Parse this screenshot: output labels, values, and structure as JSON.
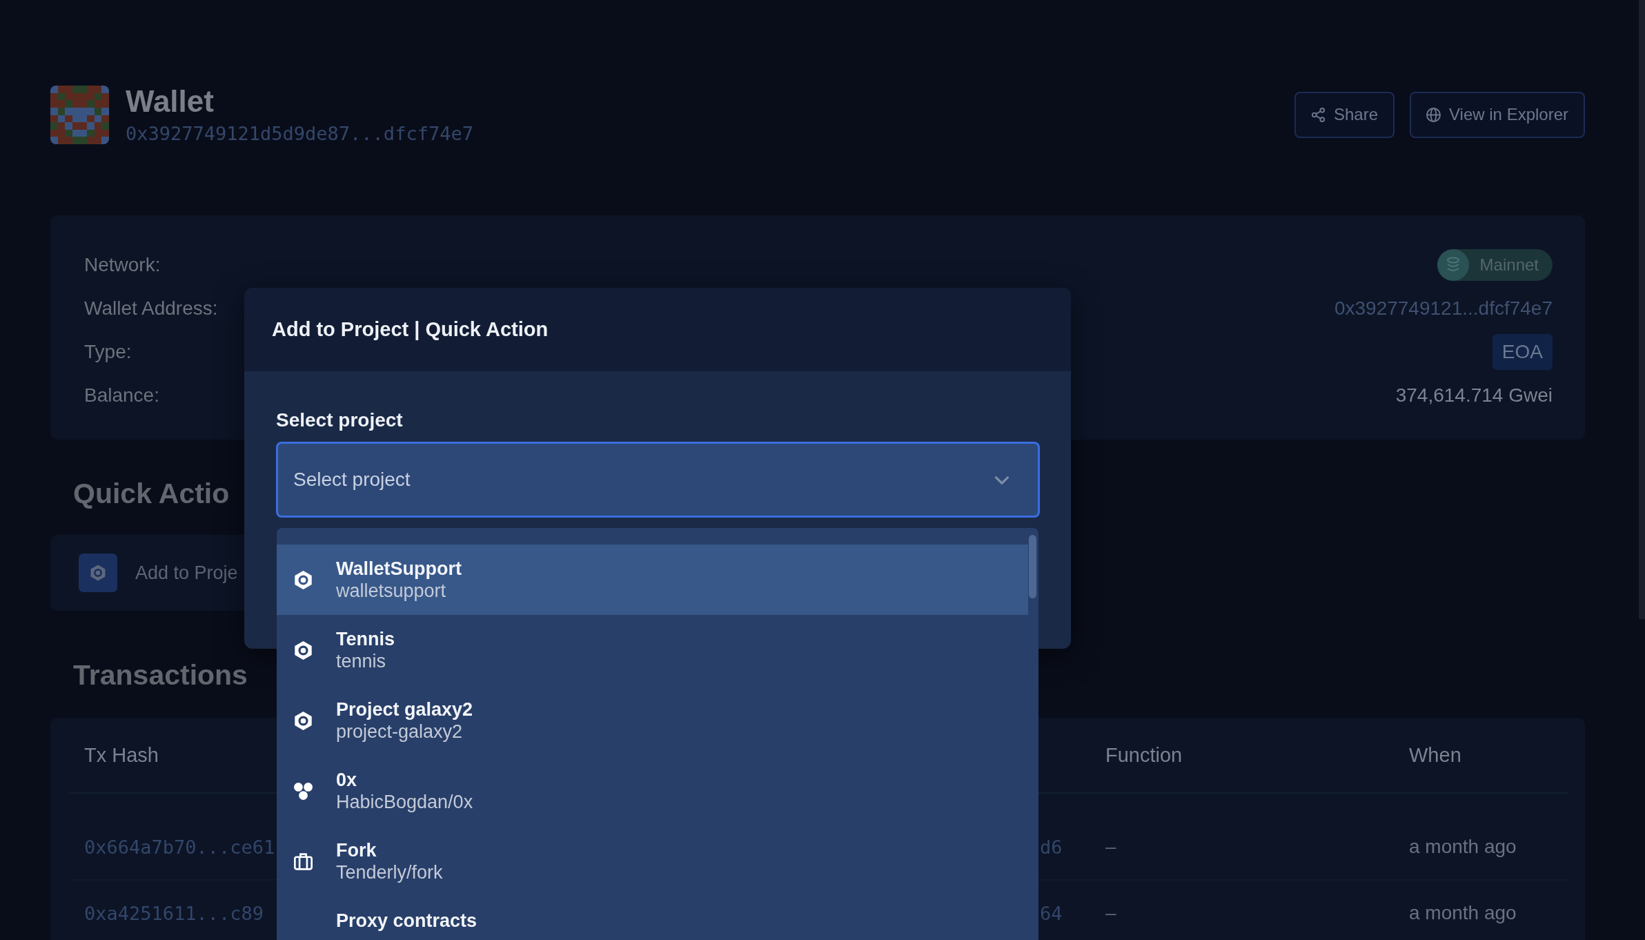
{
  "header": {
    "title": "Wallet",
    "address": "0x3927749121d5d9de87...dfcf74e7",
    "buttons": [
      {
        "label": "Share"
      },
      {
        "label": "View in Explorer"
      }
    ]
  },
  "details": [
    {
      "label": "Network:",
      "kind": "network",
      "value": "Mainnet"
    },
    {
      "label": "Wallet Address:",
      "kind": "address",
      "value": "0x3927749121...dfcf74e7"
    },
    {
      "label": "Type:",
      "kind": "tag",
      "value": "EOA"
    },
    {
      "label": "Balance:",
      "kind": "text",
      "value": "374,614.714 Gwei"
    }
  ],
  "quick_actions": {
    "heading": "Quick Actio",
    "items": [
      {
        "label": "Add to Proje"
      }
    ]
  },
  "transactions": {
    "heading": "Transactions",
    "columns": [
      "Tx Hash",
      "Function",
      "When"
    ],
    "rows": [
      {
        "tx_hash": "0x664a7b70...ce61",
        "column_2": "d6",
        "function": "–",
        "when": "a month ago"
      },
      {
        "tx_hash": "0xa4251611...c89",
        "column_2": "64",
        "function": "–",
        "when": "a month ago"
      }
    ]
  },
  "dialog": {
    "title": "Add to Project | Quick Action",
    "field_label": "Select project",
    "placeholder": "Select project",
    "options": [
      {
        "name": "WalletSupport",
        "slug": "walletsupport",
        "kind": "project",
        "selected": true
      },
      {
        "name": "Tennis",
        "slug": "tennis",
        "kind": "project",
        "selected": false
      },
      {
        "name": "Project galaxy2",
        "slug": "project-galaxy2",
        "kind": "project",
        "selected": false
      },
      {
        "name": "0x",
        "slug": "HabicBogdan/0x",
        "kind": "shared",
        "selected": false
      },
      {
        "name": "Fork",
        "slug": "Tenderly/fork",
        "kind": "fork",
        "selected": false
      },
      {
        "name": "Proxy contracts",
        "selected": false
      }
    ]
  }
}
